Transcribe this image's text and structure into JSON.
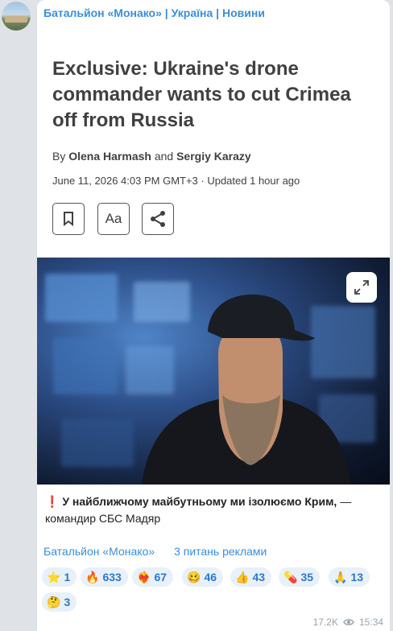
{
  "channel": {
    "name": "Батальйон «Монако» | Україна | Новини"
  },
  "article": {
    "title": "Exclusive: Ukraine's drone commander wants to cut Crimea off from Russia",
    "by_prefix": "By",
    "author1": "Olena Harmash",
    "and": "and",
    "author2": "Sergiy Karazy",
    "date": "June 11, 2026 4:03 PM GMT+3 · Updated 1 hour ago",
    "aa_label": "Aa"
  },
  "caption": {
    "mark": "❗",
    "bold_text": "У найближчому майбутньому ми ізолюємо Крим,",
    "rest": "— командир СБС Мадяр"
  },
  "links": {
    "channel": "Батальйон «Монако»",
    "ads": "3 питань реклами"
  },
  "reactions": [
    {
      "emoji": "⭐",
      "count": "1"
    },
    {
      "emoji": "🔥",
      "count": "633"
    },
    {
      "emoji": "❤️‍🔥",
      "count": "67"
    },
    {
      "emoji": "🥴",
      "count": "46"
    },
    {
      "emoji": "👍",
      "count": "43"
    },
    {
      "emoji": "💊",
      "count": "35"
    },
    {
      "emoji": "🙏",
      "count": "13"
    },
    {
      "emoji": "🤔",
      "count": "3"
    }
  ],
  "meta": {
    "views": "17.2K",
    "time": "15:34"
  },
  "colors": {
    "link": "#3a8ed8",
    "reaction_bg": "#e8f0f9",
    "reaction_text": "#2b78c9"
  }
}
